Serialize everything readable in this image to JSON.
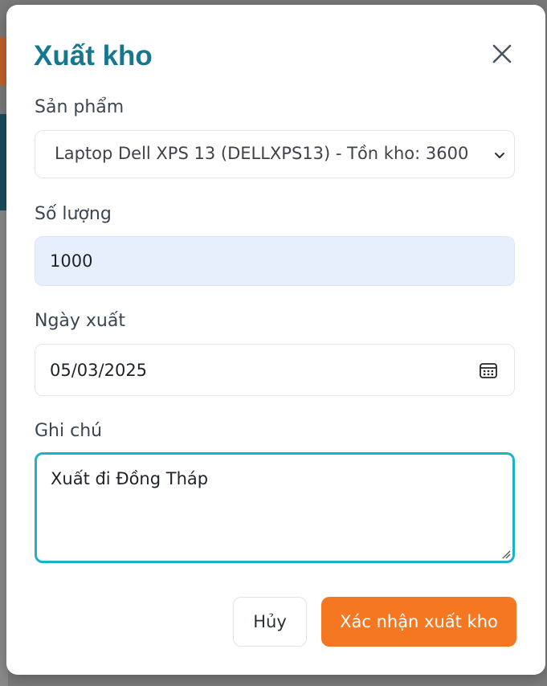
{
  "dialog": {
    "title": "Xuất kho",
    "close_icon": "close-icon"
  },
  "form": {
    "product": {
      "label": "Sản phẩm",
      "selected": "Laptop Dell XPS 13 (DELLXPS13) - Tồn kho: 3600"
    },
    "quantity": {
      "label": "Số lượng",
      "value": "1000"
    },
    "date": {
      "label": "Ngày xuất",
      "value": "05/03/2025"
    },
    "note": {
      "label": "Ghi chú",
      "value": "Xuất đi Đồng Tháp"
    }
  },
  "actions": {
    "cancel_label": "Hủy",
    "confirm_label": "Xác nhận xuất kho"
  },
  "colors": {
    "accent": "#16788f",
    "confirm": "#f57722",
    "focus": "#1bb3c9",
    "quantity_bg": "#e8effc"
  }
}
